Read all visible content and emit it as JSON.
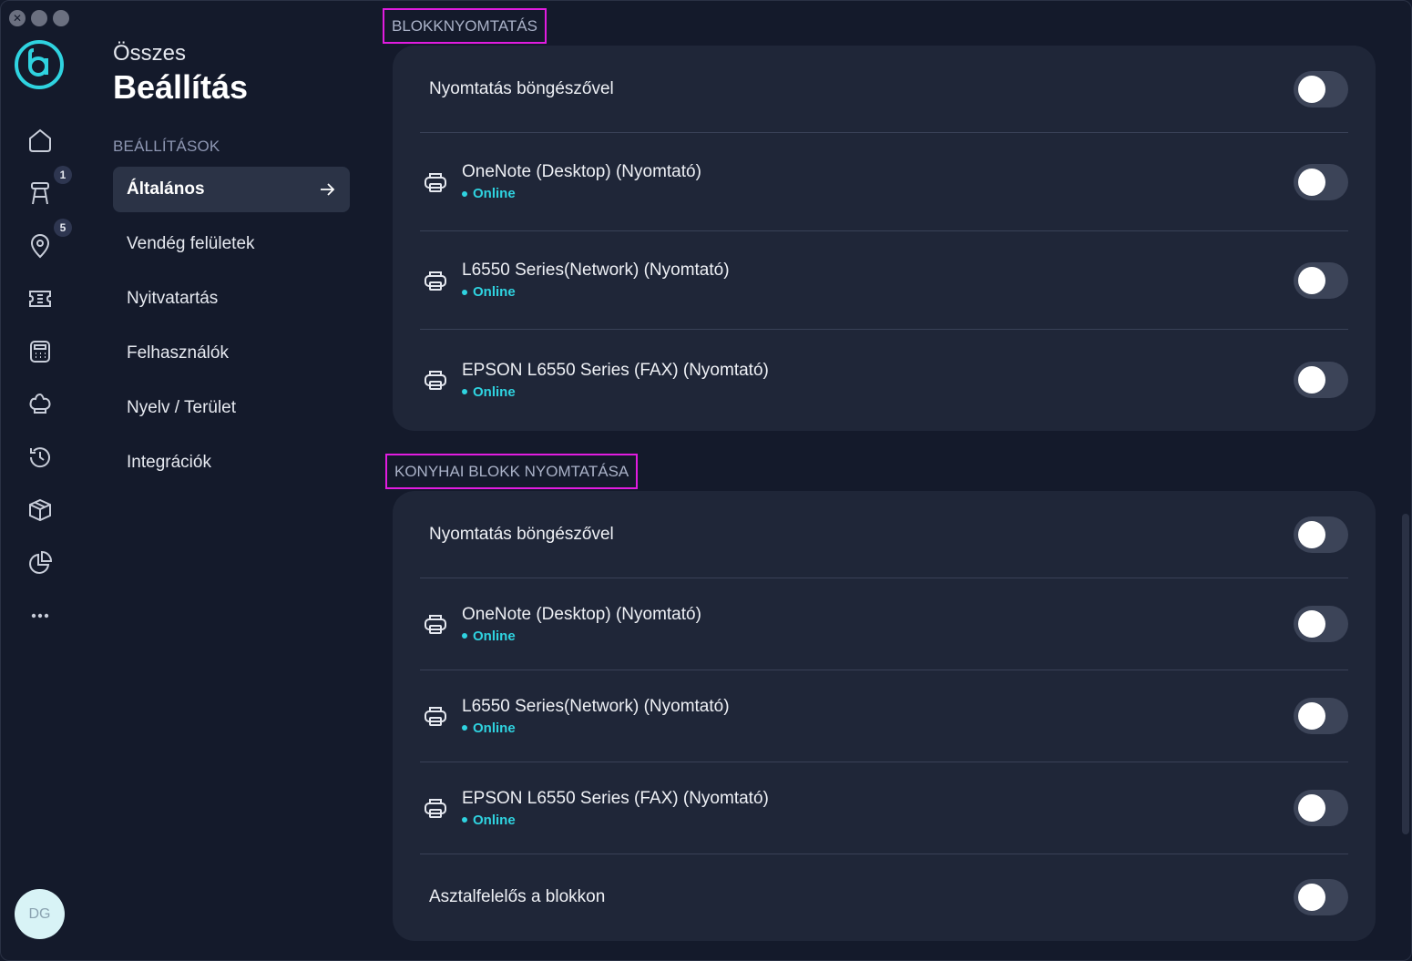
{
  "window": {
    "controls": [
      "close",
      "minimize",
      "maximize"
    ]
  },
  "rail": {
    "items": [
      {
        "icon": "home-icon"
      },
      {
        "icon": "stool-icon",
        "badge": "1"
      },
      {
        "icon": "location-pin-icon",
        "badge": "5"
      },
      {
        "icon": "ticket-icon"
      },
      {
        "icon": "calculator-icon"
      },
      {
        "icon": "chef-hat-icon"
      },
      {
        "icon": "history-icon"
      },
      {
        "icon": "box-icon"
      },
      {
        "icon": "pie-chart-icon"
      },
      {
        "icon": "more-icon"
      }
    ],
    "avatar": "DG"
  },
  "nav": {
    "subtitle": "Összes",
    "title": "Beállítás",
    "section": "BEÁLLÍTÁSOK",
    "items": [
      {
        "label": "Általános",
        "active": true
      },
      {
        "label": "Vendég felületek"
      },
      {
        "label": "Nyitvatartás"
      },
      {
        "label": "Felhasználók"
      },
      {
        "label": "Nyelv / Terület"
      },
      {
        "label": "Integrációk"
      }
    ]
  },
  "receipt": {
    "label": "BLOKKNYOMTATÁS",
    "browser_print": "Nyomtatás böngészővel",
    "printers": [
      {
        "name": "OneNote (Desktop) (Nyomtató)",
        "status": "Online"
      },
      {
        "name": "L6550 Series(Network) (Nyomtató)",
        "status": "Online"
      },
      {
        "name": "EPSON L6550 Series (FAX) (Nyomtató)",
        "status": "Online"
      }
    ]
  },
  "kitchen": {
    "label": "KONYHAI BLOKK NYOMTATÁSA",
    "browser_print": "Nyomtatás böngészővel",
    "printers": [
      {
        "name": "OneNote (Desktop) (Nyomtató)",
        "status": "Online"
      },
      {
        "name": "L6550 Series(Network) (Nyomtató)",
        "status": "Online"
      },
      {
        "name": "EPSON L6550 Series (FAX) (Nyomtató)",
        "status": "Online"
      }
    ],
    "waiter_on_receipt": "Asztalfelelős a blokkon"
  },
  "colors": {
    "accent": "#2fd3e0",
    "highlight": "#e11ce0",
    "background": "#141a2b",
    "card": "#1f2638"
  }
}
